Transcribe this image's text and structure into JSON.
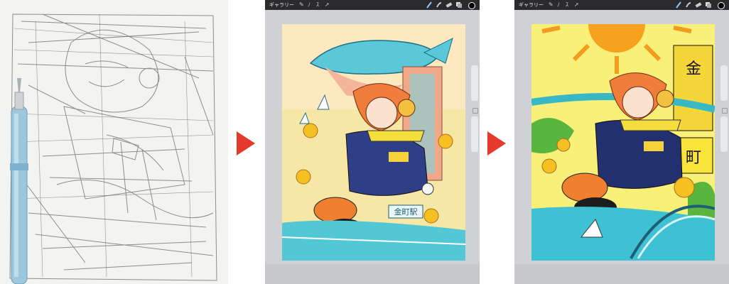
{
  "apps": [
    {
      "toolbar": {
        "gallery_label": "ギャラリー"
      }
    },
    {
      "toolbar": {
        "gallery_label": "ギャラリー"
      }
    }
  ],
  "illustration1": {
    "station_sign": "金町駅"
  },
  "illustration2": {
    "sign1": "金",
    "sign2": "町"
  },
  "colors": {
    "arrow": "#e53a2b",
    "app_bg": "#cfd1d4",
    "toolbar_bg": "#2b2b2d"
  },
  "icons": [
    "wrench-icon",
    "magic-icon",
    "selection-icon",
    "transform-icon",
    "brush-icon",
    "smudge-icon",
    "eraser-icon",
    "layers-icon",
    "color-icon"
  ]
}
